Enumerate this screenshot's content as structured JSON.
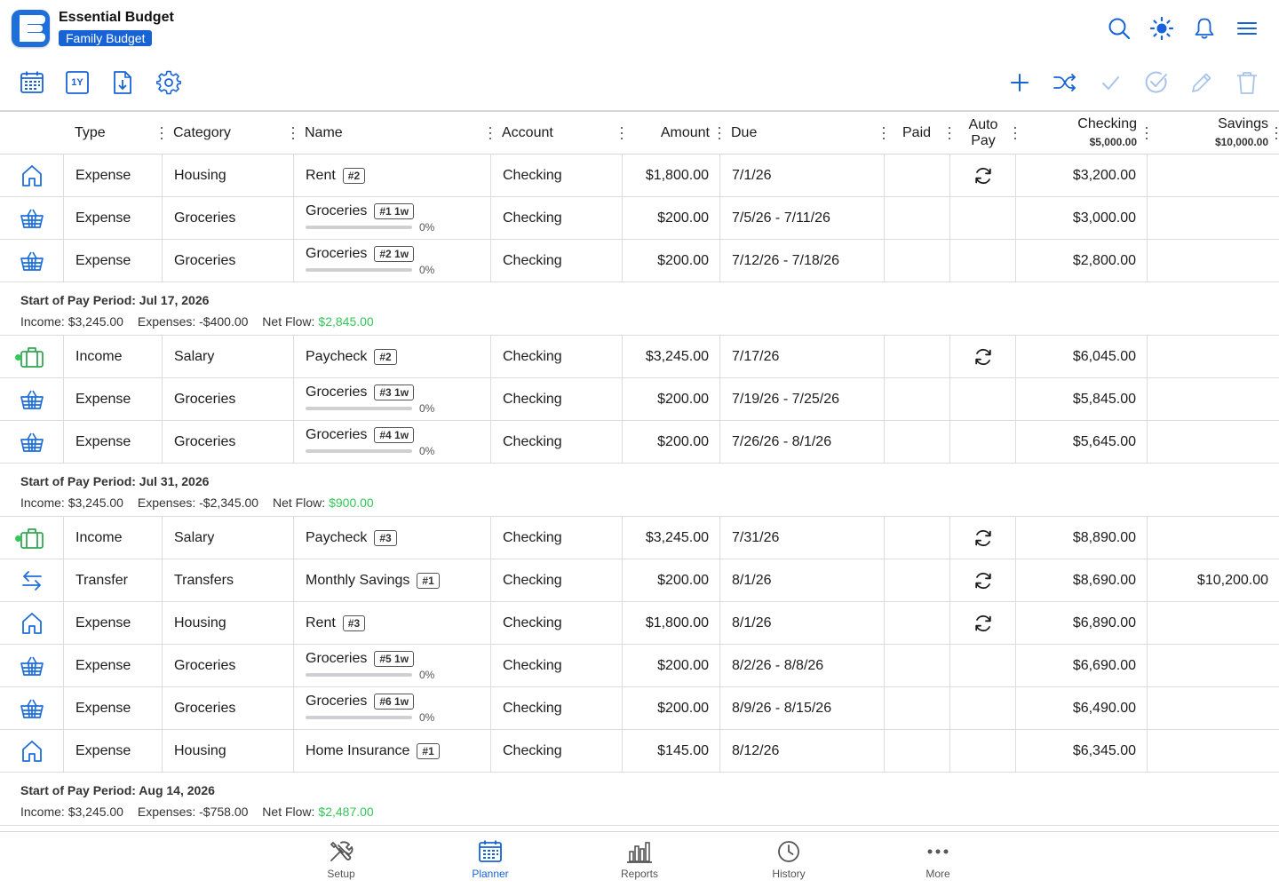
{
  "app": {
    "title": "Essential Budget",
    "budget_name": "Family Budget",
    "logo_letter": "E"
  },
  "colors": {
    "accent": "#1763d6",
    "icon_blue": "#1e6fd9",
    "positive": "#34c759",
    "disabled": "#a8c4ea"
  },
  "header_icons": [
    "search-icon",
    "brightness-icon",
    "bell-icon",
    "hamburger-menu-icon"
  ],
  "toolbar": {
    "left": [
      "calendar-icon",
      "one-year-icon",
      "export-icon",
      "settings-icon"
    ],
    "one_year_label": "1Y",
    "right": [
      "add-icon",
      "shuffle-icon",
      "check-icon",
      "check-circle-icon",
      "pencil-icon",
      "trash-icon"
    ]
  },
  "columns": {
    "type": "Type",
    "category": "Category",
    "name": "Name",
    "account": "Account",
    "amount": "Amount",
    "due": "Due",
    "paid": "Paid",
    "autopay_1": "Auto",
    "autopay_2": "Pay",
    "checking": "Checking",
    "checking_balance": "$5,000.00",
    "savings": "Savings",
    "savings_balance": "$10,000.00"
  },
  "rows": [
    {
      "icon": "house-icon",
      "type": "Expense",
      "category": "Housing",
      "name": "Rent",
      "tag": "#2",
      "account": "Checking",
      "amount": "$1,800.00",
      "due": "7/1/26",
      "autopay": true,
      "checking": "$3,200.00",
      "savings": ""
    },
    {
      "icon": "basket-icon",
      "type": "Expense",
      "category": "Groceries",
      "name": "Groceries",
      "tag": "#1 1w",
      "progress": "0%",
      "account": "Checking",
      "amount": "$200.00",
      "due": "7/5/26 - 7/11/26",
      "checking": "$3,000.00",
      "savings": ""
    },
    {
      "icon": "basket-icon",
      "type": "Expense",
      "category": "Groceries",
      "name": "Groceries",
      "tag": "#2 1w",
      "progress": "0%",
      "account": "Checking",
      "amount": "$200.00",
      "due": "7/12/26 - 7/18/26",
      "checking": "$2,800.00",
      "savings": ""
    },
    {
      "period": true,
      "title": "Start of Pay Period: Jul 17, 2026",
      "income": "Income: $3,245.00",
      "expenses": "Expenses: -$400.00",
      "net_label": "Net Flow:",
      "net_value": "$2,845.00"
    },
    {
      "icon": "briefcase-icon",
      "dot": true,
      "type": "Income",
      "category": "Salary",
      "name": "Paycheck",
      "tag": "#2",
      "account": "Checking",
      "amount": "$3,245.00",
      "due": "7/17/26",
      "autopay": true,
      "checking": "$6,045.00",
      "savings": ""
    },
    {
      "icon": "basket-icon",
      "type": "Expense",
      "category": "Groceries",
      "name": "Groceries",
      "tag": "#3 1w",
      "progress": "0%",
      "account": "Checking",
      "amount": "$200.00",
      "due": "7/19/26 - 7/25/26",
      "checking": "$5,845.00",
      "savings": ""
    },
    {
      "icon": "basket-icon",
      "type": "Expense",
      "category": "Groceries",
      "name": "Groceries",
      "tag": "#4 1w",
      "progress": "0%",
      "account": "Checking",
      "amount": "$200.00",
      "due": "7/26/26 - 8/1/26",
      "checking": "$5,645.00",
      "savings": ""
    },
    {
      "period": true,
      "title": "Start of Pay Period: Jul 31, 2026",
      "income": "Income: $3,245.00",
      "expenses": "Expenses: -$2,345.00",
      "net_label": "Net Flow:",
      "net_value": "$900.00"
    },
    {
      "icon": "briefcase-icon",
      "dot": true,
      "type": "Income",
      "category": "Salary",
      "name": "Paycheck",
      "tag": "#3",
      "account": "Checking",
      "amount": "$3,245.00",
      "due": "7/31/26",
      "autopay": true,
      "checking": "$8,890.00",
      "savings": ""
    },
    {
      "icon": "transfer-icon",
      "type": "Transfer",
      "category": "Transfers",
      "name": "Monthly Savings",
      "tag": "#1",
      "account": "Checking",
      "amount": "$200.00",
      "due": "8/1/26",
      "autopay": true,
      "checking": "$8,690.00",
      "savings": "$10,200.00"
    },
    {
      "icon": "house-icon",
      "type": "Expense",
      "category": "Housing",
      "name": "Rent",
      "tag": "#3",
      "account": "Checking",
      "amount": "$1,800.00",
      "due": "8/1/26",
      "autopay": true,
      "checking": "$6,890.00",
      "savings": ""
    },
    {
      "icon": "basket-icon",
      "type": "Expense",
      "category": "Groceries",
      "name": "Groceries",
      "tag": "#5 1w",
      "progress": "0%",
      "account": "Checking",
      "amount": "$200.00",
      "due": "8/2/26 - 8/8/26",
      "checking": "$6,690.00",
      "savings": ""
    },
    {
      "icon": "basket-icon",
      "type": "Expense",
      "category": "Groceries",
      "name": "Groceries",
      "tag": "#6 1w",
      "progress": "0%",
      "account": "Checking",
      "amount": "$200.00",
      "due": "8/9/26 - 8/15/26",
      "checking": "$6,490.00",
      "savings": ""
    },
    {
      "icon": "house-icon",
      "type": "Expense",
      "category": "Housing",
      "name": "Home Insurance",
      "tag": "#1",
      "account": "Checking",
      "amount": "$145.00",
      "due": "8/12/26",
      "checking": "$6,345.00",
      "savings": ""
    },
    {
      "period": true,
      "title": "Start of Pay Period: Aug 14, 2026",
      "income": "Income: $3,245.00",
      "expenses": "Expenses: -$758.00",
      "net_label": "Net Flow:",
      "net_value": "$2,487.00"
    }
  ],
  "nav": [
    {
      "label": "Setup",
      "icon": "tools-icon",
      "active": false
    },
    {
      "label": "Planner",
      "icon": "calendar-icon",
      "active": true
    },
    {
      "label": "Reports",
      "icon": "bar-chart-icon",
      "active": false
    },
    {
      "label": "History",
      "icon": "clock-icon",
      "active": false
    },
    {
      "label": "More",
      "icon": "ellipsis-icon",
      "active": false
    }
  ]
}
